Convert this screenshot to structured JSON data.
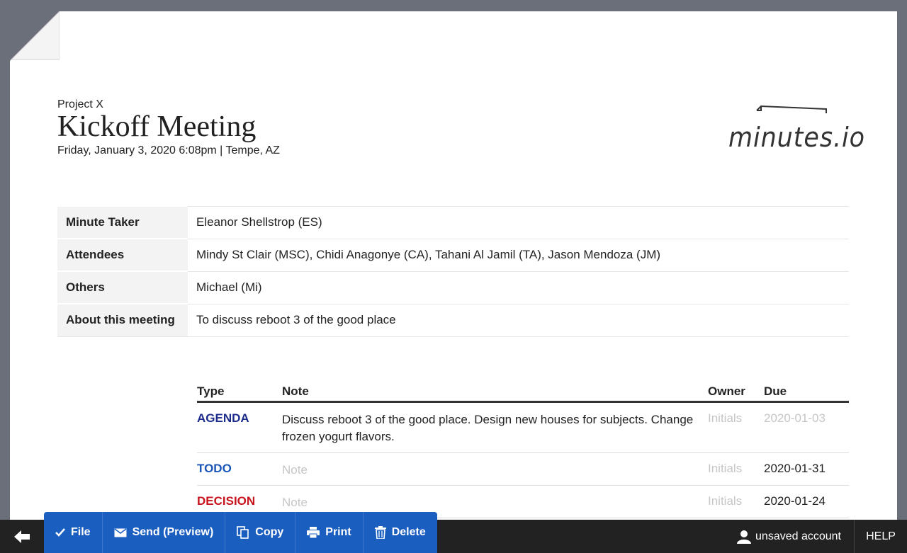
{
  "header": {
    "project": "Project X",
    "title": "Kickoff Meeting",
    "subtitle": "Friday, January 3, 2020 6:08pm | Tempe, AZ"
  },
  "logo": {
    "text": "minutes.io"
  },
  "meta": [
    {
      "label": "Minute Taker",
      "value": "Eleanor Shellstrop (ES)"
    },
    {
      "label": "Attendees",
      "value": "Mindy St Clair (MSC), Chidi Anagonye (CA), Tahani Al Jamil (TA), Jason Mendoza (JM)"
    },
    {
      "label": "Others",
      "value": "Michael (Mi)"
    },
    {
      "label": "About this meeting",
      "value": "To discuss reboot 3 of the good place"
    }
  ],
  "notes": {
    "headers": {
      "type": "Type",
      "note": "Note",
      "owner": "Owner",
      "due": "Due"
    },
    "rows": [
      {
        "type": "AGENDA",
        "note": "Discuss reboot 3 of the good place. Design new houses for subjects. Change frozen yogurt flavors.",
        "owner": "Initials",
        "due": "2020-01-03"
      },
      {
        "type": "TODO",
        "note": "Note",
        "owner": "Initials",
        "due": "2020-01-31"
      },
      {
        "type": "DECISION",
        "note": "Note",
        "owner": "Initials",
        "due": "2020-01-24"
      }
    ]
  },
  "toolbar": {
    "file": "File",
    "send": "Send (Preview)",
    "copy": "Copy",
    "print": "Print",
    "delete": "Delete"
  },
  "footer": {
    "account": "unsaved account",
    "help": "HELP"
  },
  "colors": {
    "agenda": "#1d2d8c",
    "todo": "#1a56b8",
    "decision": "#c8141c",
    "toolbar": "#1a5fc0"
  }
}
